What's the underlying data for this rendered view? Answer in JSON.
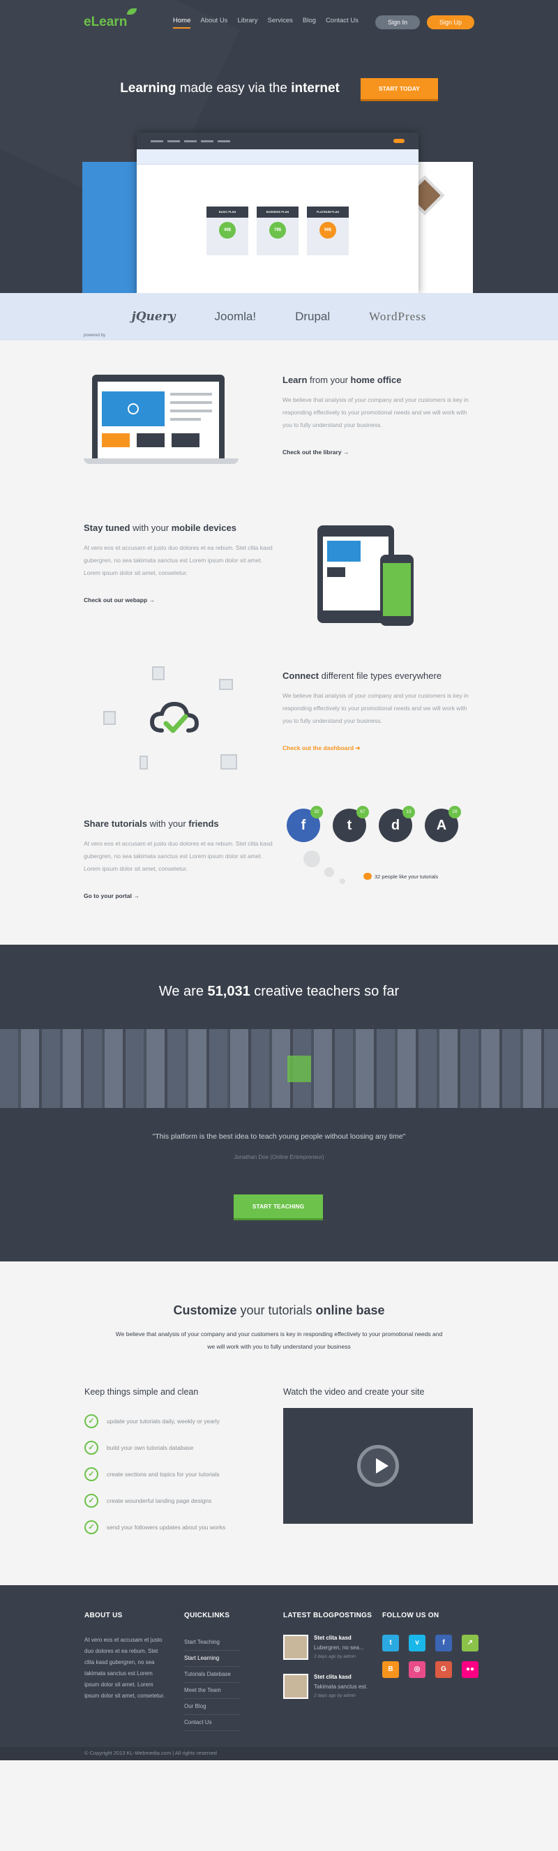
{
  "brand": {
    "logo": "eLearn"
  },
  "nav": {
    "items": [
      "Home",
      "About Us",
      "Library",
      "Services",
      "Blog",
      "Contact Us"
    ],
    "signin": "Sign In",
    "signup": "Sign Up"
  },
  "hero": {
    "headline_pre": "Learning",
    "headline_mid": " made easy via the ",
    "headline_post": "internet",
    "cta": "START TODAY",
    "mock": {
      "plans": [
        {
          "name": "BASIC PLAN",
          "price": "49$",
          "color": "#6cc24a"
        },
        {
          "name": "BUSINESS PLAN",
          "price": "79$",
          "color": "#6cc24a"
        },
        {
          "name": "PLATINUM PLAN",
          "price": "99$",
          "color": "#f7941e"
        }
      ]
    }
  },
  "partners": {
    "powered": "powered by",
    "logos": [
      "jQuery",
      "Joomla!",
      "Drupal",
      "WordPress"
    ]
  },
  "features": [
    {
      "title_b": "Learn",
      "title_rest": " from your ",
      "title_b2": "home office",
      "text": "We believe that analysis of your company and your customers is key in responding effectively to your promotional needs and we will work with you to fully understand your business.",
      "link": "Check out the library",
      "arrow": "→"
    },
    {
      "title_b": "Stay tuned",
      "title_rest": " with your ",
      "title_b2": "mobile devices",
      "text": "At vero eos et accusam et justo duo dolores et ea rebum. Stet clita kasd gubergren, no sea takimata sanctus est Lorem ipsum dolor sit amet. Lorem ipsum dolor sit amet, consetetur.",
      "link": "Check out our webapp",
      "arrow": "→"
    },
    {
      "title_b": "Connect",
      "title_rest": " different file types everywhere",
      "title_b2": "",
      "text": "We believe that analysis of your company and your customers is key in responding effectively to your promotional needs and we will work with you to fully understand your business.",
      "link": "Check out the dashboard",
      "arrow": "➜"
    },
    {
      "title_b": "Share tutorials",
      "title_rest": " with your ",
      "title_b2": "friends",
      "text": "At vero eos et accusam et justo duo dolores et ea rebum. Stet clita kasd gubergren, no sea takimata sanctus est Lorem ipsum dolor sit amet. Lorem ipsum dolor sit amet, consetetur.",
      "link": "Go to your portal",
      "arrow": "→"
    }
  ],
  "social_counts": [
    {
      "icon": "f",
      "count": "32"
    },
    {
      "icon": "t",
      "count": "67"
    },
    {
      "icon": "d",
      "count": "13"
    },
    {
      "icon": "A",
      "count": "28"
    }
  ],
  "likes": "32 people like your tutorials",
  "teachers": {
    "pre": "We are ",
    "count": "51,031",
    "post": " creative teachers so far",
    "quote": "\"This platform is the best idea to teach young people without loosing any time\"",
    "author": "Jonathan Doe (Online Entrepreneur)",
    "cta": "START TEACHING"
  },
  "customize": {
    "title_b": "Customize",
    "title_mid": " your tutorials ",
    "title_b2": "online base",
    "lead": "We believe that analysis of your company and your customers is key in responding effectively to your promotional needs and we will work with you to fully understand your business",
    "left_title": "Keep things simple and clean",
    "checks": [
      "update your tutorials daily, weekly or yearly",
      "build your own tutorials database",
      "create sections and topics for your tutorials",
      "create wounderful landing page designs",
      "send your followers updates about you works"
    ],
    "right_title": "Watch the video and create your site"
  },
  "footer": {
    "about_title": "ABOUT US",
    "about_text": "At vero eos et accusam et justo duo dolores et ea rebum. Stet clita kasd gubergren, no sea takimata sanctus est Lorem ipsum dolor sit amet. Lorem ipsum dolor sit amet, consetetur.",
    "quick_title": "QUICKLINKS",
    "quick": [
      "Start Teaching",
      "Start Learning",
      "Tutorials Datebase",
      "Meet the Team",
      "Our Blog",
      "Contact Us"
    ],
    "blog_title": "LATEST BLOGPOSTINGS",
    "posts": [
      {
        "title": "Stet clita kasd",
        "excerpt": "Lubergren, no sea...",
        "meta": "2 days ago by admin"
      },
      {
        "title": "Stet clita kasd",
        "excerpt": "Takimata sanctus est.",
        "meta": "2 days ago by admin"
      }
    ],
    "follow_title": "FOLLOW US ON",
    "socials": [
      {
        "icon": "twitter-icon",
        "glyph": "t",
        "color": "#2ba9e1"
      },
      {
        "icon": "vimeo-icon",
        "glyph": "v",
        "color": "#1ab7ea"
      },
      {
        "icon": "facebook-icon",
        "glyph": "f",
        "color": "#3b65b5"
      },
      {
        "icon": "share-icon",
        "glyph": "↗",
        "color": "#8bc34a"
      },
      {
        "icon": "blogger-icon",
        "glyph": "B",
        "color": "#f7941e"
      },
      {
        "icon": "dribbble-icon",
        "glyph": "◎",
        "color": "#ea4c89"
      },
      {
        "icon": "google-icon",
        "glyph": "G",
        "color": "#dd5a43"
      },
      {
        "icon": "flickr-icon",
        "glyph": "●●",
        "color": "#ff0084"
      }
    ],
    "copyright": "© Copyright 2013 KL-Webmedia.com | All rights reserved"
  }
}
